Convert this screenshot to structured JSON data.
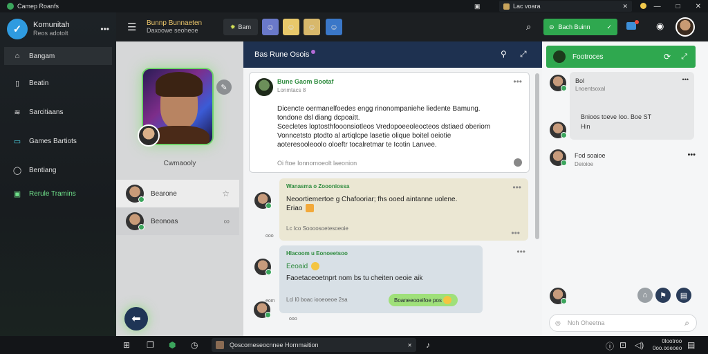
{
  "window": {
    "app_title": "Camep Roanfs",
    "tab_title": "Lac voara",
    "controls": [
      "—",
      "□",
      "✕"
    ]
  },
  "sidebar": {
    "brand_title": "Komunitah",
    "brand_sub": "Reos adotolt",
    "items": [
      {
        "label": "Bangam",
        "icon": "home-icon"
      },
      {
        "label": "Beatin",
        "icon": "bookmark-icon"
      },
      {
        "label": "Sarcitiaans",
        "icon": "sliders-icon"
      },
      {
        "label": "Games Bartiots",
        "icon": "gamepad-icon"
      },
      {
        "label": "Bentiang",
        "icon": "settings-icon"
      },
      {
        "label": "Rerule Tramins",
        "icon": "grid-icon"
      }
    ]
  },
  "topbar": {
    "title": "Bunnp Bunnaeten",
    "subtitle": "Daxoowe seoheoe",
    "star_label": "Bam",
    "green_label": "Bach Buinn",
    "green_check": "✓"
  },
  "people": {
    "hero_name": "Cwmaooly",
    "contacts": [
      {
        "name": "Bearone",
        "icon": "☆"
      },
      {
        "name": "Beonoas",
        "icon": "∞"
      }
    ]
  },
  "chat": {
    "channel_title": "Bas Rune Osois",
    "post": {
      "author": "Bune Gaom Bootaf",
      "time": "Lonmtacs 8",
      "lines": [
        "Dicencte oermanelfoedes engg rinonompaniehe liedente Bamung.",
        "tondone dsl diang dcpoaitt.",
        "Scecletes loptosthfooonsiotleos Vredopoeeoleocteos dstiaed oberiom",
        "Vonncetsto ptodto al artiqlcpe lasetie olique boitel oeiotie",
        "aoteresooleoolo oloeftr tocalretmar te Icotin Lanvee."
      ],
      "footer": "Oi ftoe Ionnomoeolt laeonion"
    },
    "bubble1": {
      "name": "Wanasma o Zoooniossa",
      "text": "Neoortiemertoe g Chafooriar; fhs ooed aintanne uolene.",
      "text2": "Eriao",
      "meta": "Lc Ico Soooosoetesoeoie"
    },
    "bubble2": {
      "name": "Hlacoom u Eonoeetsoo",
      "text": "Eeoaid",
      "text2": "Faoetaceoetnprt nom bs tu cheiten oeoie aik",
      "meta": "Lcl l0 boac iooeoeoe 2sa",
      "pill": "Boaneeooeifoe pos"
    },
    "timestamps": [
      "ooo",
      "eom",
      "ooo"
    ]
  },
  "right": {
    "header": "Footroces",
    "card": {
      "name": "Bol",
      "sub": "Lnoentsoxal",
      "line1": "Bnioos toeve Ioo. Boe ST",
      "line2": "Hin"
    },
    "entry_name": "Fod soaioe",
    "entry_sub": "Deioioe",
    "compose_placeholder": "Noh Oheetna"
  },
  "taskbar": {
    "task_label": "Qoscomeseocnnee Hornmaition",
    "time": "0lootroo",
    "date": "0oo.ooeoeo"
  },
  "colors": {
    "accent_green": "#2fa84f",
    "header_navy": "#1e3150",
    "status_online": "#3ba55c"
  }
}
